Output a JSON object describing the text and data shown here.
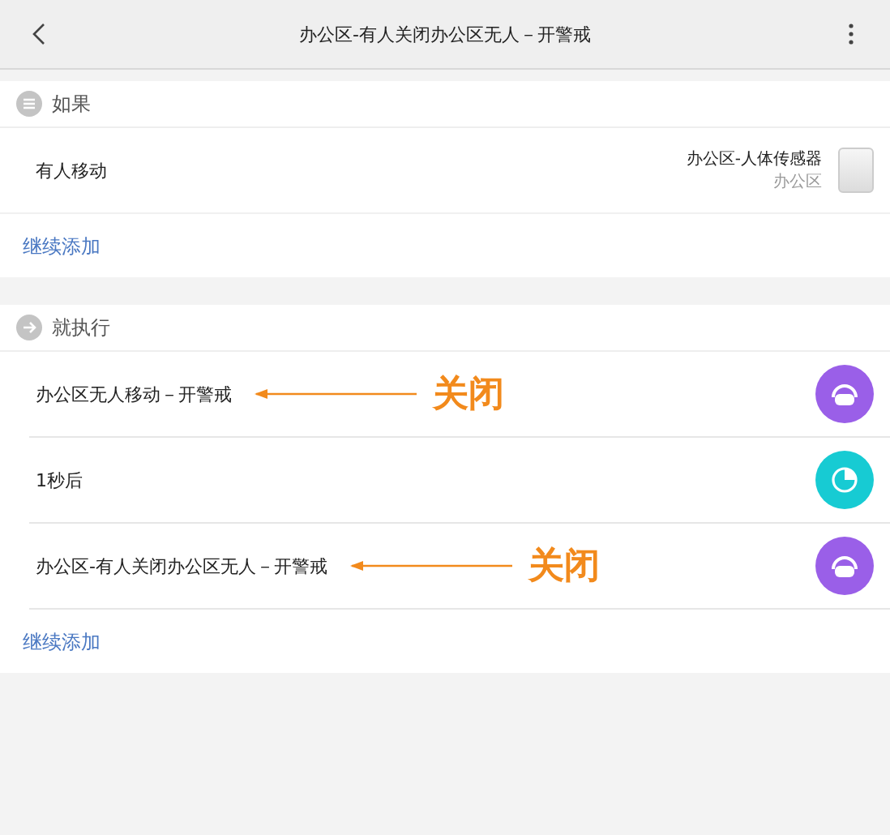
{
  "header": {
    "title": "办公区-有人关闭办公区无人－开警戒"
  },
  "if_section": {
    "title": "如果",
    "conditions": [
      {
        "label": "有人移动",
        "device_name": "办公区-人体传感器",
        "device_room": "办公区"
      }
    ],
    "add_link": "继续添加"
  },
  "then_section": {
    "title": "就执行",
    "actions": [
      {
        "kind": "scene",
        "label": "办公区无人移动－开警戒",
        "annotation": "关闭"
      },
      {
        "kind": "delay",
        "label": "1秒后"
      },
      {
        "kind": "scene",
        "label": "办公区-有人关闭办公区无人－开警戒",
        "annotation": "关闭"
      }
    ],
    "add_link": "继续添加"
  }
}
